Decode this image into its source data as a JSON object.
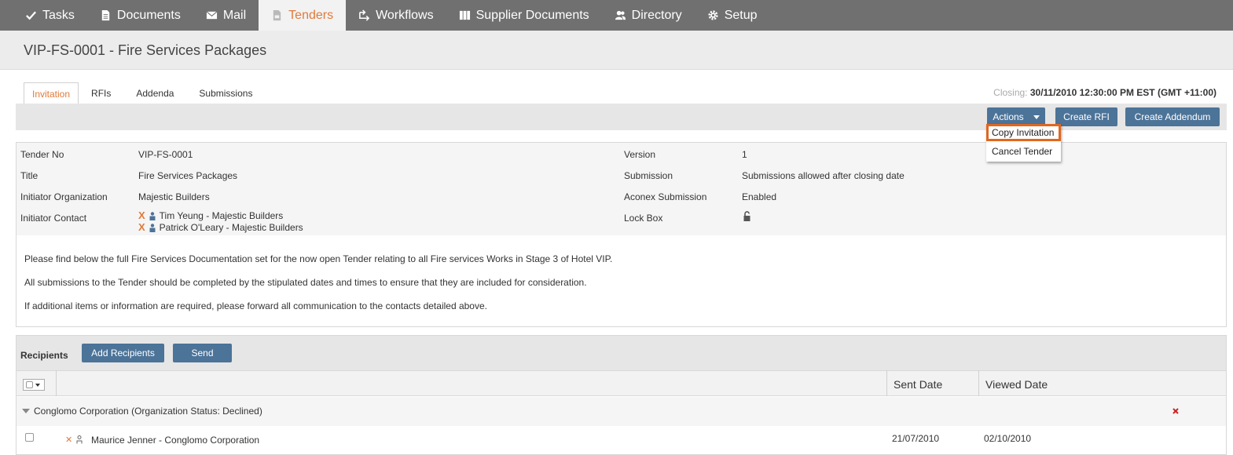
{
  "nav": {
    "items": [
      {
        "label": "Tasks",
        "icon": "check-icon"
      },
      {
        "label": "Documents",
        "icon": "document-icon"
      },
      {
        "label": "Mail",
        "icon": "mail-icon"
      },
      {
        "label": "Tenders",
        "icon": "tender-icon",
        "active": true
      },
      {
        "label": "Workflows",
        "icon": "workflow-icon"
      },
      {
        "label": "Supplier Documents",
        "icon": "binders-icon"
      },
      {
        "label": "Directory",
        "icon": "people-icon"
      },
      {
        "label": "Setup",
        "icon": "gear-icon"
      }
    ]
  },
  "page": {
    "title": "VIP-FS-0001 - Fire Services Packages"
  },
  "tabs": [
    "Invitation",
    "RFIs",
    "Addenda",
    "Submissions"
  ],
  "closing": {
    "label": "Closing:",
    "value": "30/11/2010 12:30:00 PM EST (GMT +11:00)"
  },
  "toolbar": {
    "actions_label": "Actions",
    "create_rfi_label": "Create RFI",
    "create_addendum_label": "Create Addendum"
  },
  "actions_menu": [
    "Copy Invitation",
    "Cancel Tender"
  ],
  "details": {
    "left": [
      {
        "label": "Tender No",
        "value": "VIP-FS-0001"
      },
      {
        "label": "Title",
        "value": "Fire Services Packages"
      },
      {
        "label": "Initiator Organization",
        "value": "Majestic Builders"
      },
      {
        "label": "Initiator Contact",
        "value": ""
      }
    ],
    "contacts": [
      "Tim Yeung - Majestic Builders",
      "Patrick O'Leary - Majestic Builders"
    ],
    "right": [
      {
        "label": "Version",
        "value": "1"
      },
      {
        "label": "Submission",
        "value": "Submissions allowed after closing date"
      },
      {
        "label": "Aconex Submission",
        "value": "Enabled"
      },
      {
        "label": "Lock Box",
        "value": ""
      }
    ],
    "paragraphs": [
      "Please find below the full Fire Services Documentation set for the now open Tender relating to all Fire services Works in Stage 3 of Hotel VIP.",
      "All submissions to the Tender should be completed by the stipulated dates and times to ensure that they are included for consideration.",
      "If additional items or information are required, please forward all communication to the contacts detailed above."
    ]
  },
  "recipients": {
    "title": "Recipients",
    "add_label": "Add Recipients",
    "send_label": "Send",
    "columns": {
      "sent": "Sent Date",
      "viewed": "Viewed Date"
    },
    "group": "Conglomo Corporation (Organization Status: Declined)",
    "rows": [
      {
        "name": "Maurice Jenner - Conglomo Corporation",
        "sent": "21/07/2010",
        "viewed": "02/10/2010"
      }
    ]
  },
  "colors": {
    "nav_bg": "#707070",
    "accent": "#e07a3a",
    "button": "#4c7398",
    "highlight": "#e0671f"
  }
}
